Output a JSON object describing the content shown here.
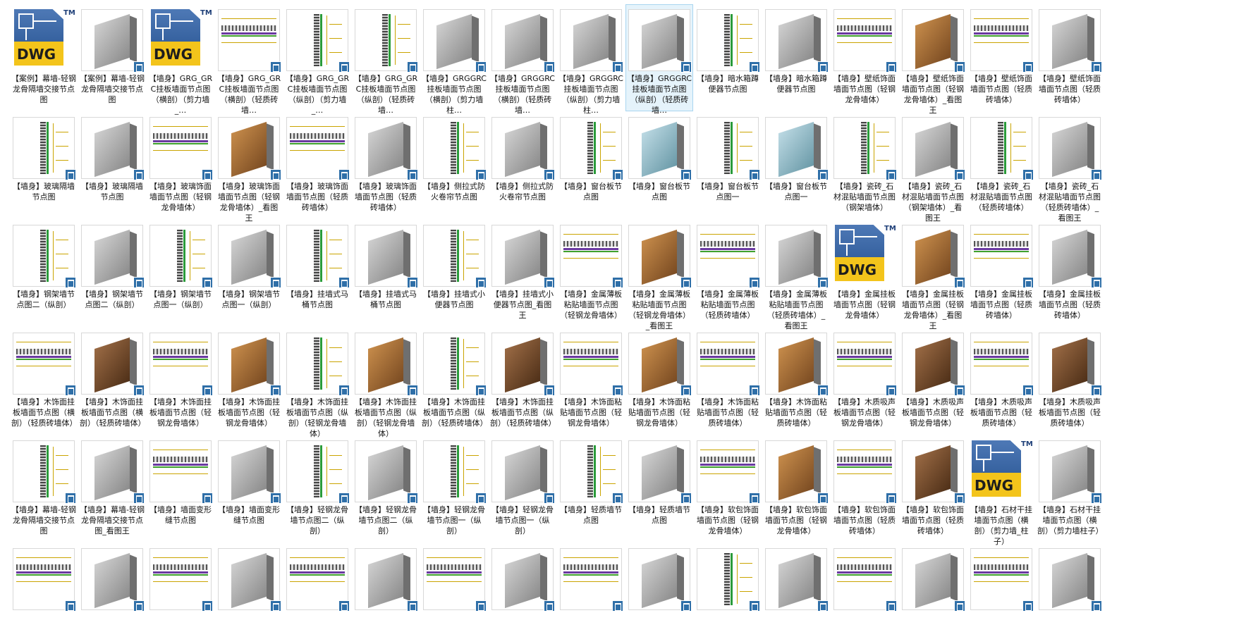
{
  "items": [
    {
      "label": "【案例】幕墙-轻钢龙骨隔墙交接节点图",
      "thumb": "dwg"
    },
    {
      "label": "【案例】幕墙-轻钢龙骨隔墙交接节点图",
      "thumb": "render"
    },
    {
      "label": "【墙身】GRG_GRC挂板墙面节点图（横剖）（剪力墙_…",
      "thumb": "dwg"
    },
    {
      "label": "【墙身】GRG_GRC挂板墙面节点图（横剖）（轻质砖墙…",
      "thumb": "plan"
    },
    {
      "label": "【墙身】GRG_GRC挂板墙面节点图（纵剖）（剪力墙_…",
      "thumb": "section"
    },
    {
      "label": "【墙身】GRG_GRC挂板墙面节点图（纵剖）（轻质砖墙…",
      "thumb": "section"
    },
    {
      "label": "【墙身】GRGGRC挂板墙面节点图（横剖）（剪力墙柱…",
      "thumb": "render"
    },
    {
      "label": "【墙身】GRGGRC挂板墙面节点图（横剖）（轻质砖墙…",
      "thumb": "render"
    },
    {
      "label": "【墙身】GRGGRC挂板墙面节点图（纵剖）（剪力墙柱…",
      "thumb": "render"
    },
    {
      "label": "【墙身】GRGGRC挂板墙面节点图（纵剖）（轻质砖墙…",
      "thumb": "render",
      "selected": true
    },
    {
      "label": "【墙身】暗水箱蹲便器节点图",
      "thumb": "section"
    },
    {
      "label": "【墙身】暗水箱蹲便器节点图",
      "thumb": "render"
    },
    {
      "label": "【墙身】壁纸饰面墙面节点图（轻钢龙骨墙体）",
      "thumb": "plan"
    },
    {
      "label": "【墙身】壁纸饰面墙面节点图（轻钢龙骨墙体）_看图王",
      "thumb": "render-wood"
    },
    {
      "label": "【墙身】壁纸饰面墙面节点图（轻质砖墙体）",
      "thumb": "plan"
    },
    {
      "label": "【墙身】壁纸饰面墙面节点图（轻质砖墙体）",
      "thumb": "render"
    },
    {
      "label": "【墙身】玻璃隔墙节点图",
      "thumb": "section"
    },
    {
      "label": "【墙身】玻璃隔墙节点图",
      "thumb": "render"
    },
    {
      "label": "【墙身】玻璃饰面墙面节点图（轻钢龙骨墙体）",
      "thumb": "plan"
    },
    {
      "label": "【墙身】玻璃饰面墙面节点图（轻钢龙骨墙体）_看图王",
      "thumb": "render-wood"
    },
    {
      "label": "【墙身】玻璃饰面墙面节点图（轻质砖墙体）",
      "thumb": "plan"
    },
    {
      "label": "【墙身】玻璃饰面墙面节点图（轻质砖墙体）",
      "thumb": "render"
    },
    {
      "label": "【墙身】侧拉式防火卷帘节点图",
      "thumb": "section"
    },
    {
      "label": "【墙身】侧拉式防火卷帘节点图",
      "thumb": "render"
    },
    {
      "label": "【墙身】窗台板节点图",
      "thumb": "section"
    },
    {
      "label": "【墙身】窗台板节点图",
      "thumb": "render-glass"
    },
    {
      "label": "【墙身】窗台板节点图一",
      "thumb": "section"
    },
    {
      "label": "【墙身】窗台板节点图一",
      "thumb": "render-glass"
    },
    {
      "label": "【墙身】瓷砖_石材混贴墙面节点图（钢架墙体）",
      "thumb": "section"
    },
    {
      "label": "【墙身】瓷砖_石材混贴墙面节点图（钢架墙体）_看图王",
      "thumb": "render"
    },
    {
      "label": "【墙身】瓷砖_石材混贴墙面节点图（轻质砖墙体）",
      "thumb": "section"
    },
    {
      "label": "【墙身】瓷砖_石材混贴墙面节点图（轻质砖墙体）_看图王",
      "thumb": "render"
    },
    {
      "label": "【墙身】钢架墙节点图二（纵剖）",
      "thumb": "section"
    },
    {
      "label": "【墙身】钢架墙节点图二（纵剖）",
      "thumb": "render"
    },
    {
      "label": "【墙身】钢架墙节点图一（纵剖）",
      "thumb": "section"
    },
    {
      "label": "【墙身】钢架墙节点图一（纵剖）",
      "thumb": "render"
    },
    {
      "label": "【墙身】挂墙式马桶节点图",
      "thumb": "section"
    },
    {
      "label": "【墙身】挂墙式马桶节点图",
      "thumb": "render"
    },
    {
      "label": "【墙身】挂墙式小便器节点图",
      "thumb": "section"
    },
    {
      "label": "【墙身】挂墙式小便器节点图_看图王",
      "thumb": "render"
    },
    {
      "label": "【墙身】金属薄板粘贴墙面节点图（轻钢龙骨墙体）",
      "thumb": "plan"
    },
    {
      "label": "【墙身】金属薄板粘贴墙面节点图（轻钢龙骨墙体）_看图王",
      "thumb": "render-wood"
    },
    {
      "label": "【墙身】金属薄板粘贴墙面节点图（轻质砖墙体）",
      "thumb": "plan"
    },
    {
      "label": "【墙身】金属薄板粘贴墙面节点图（轻质砖墙体）_看图王",
      "thumb": "render"
    },
    {
      "label": "【墙身】金属挂板墙面节点图（轻钢龙骨墙体）",
      "thumb": "dwg"
    },
    {
      "label": "【墙身】金属挂板墙面节点图（轻钢龙骨墙体）_看图王",
      "thumb": "render-wood"
    },
    {
      "label": "【墙身】金属挂板墙面节点图（轻质砖墙体）",
      "thumb": "plan"
    },
    {
      "label": "【墙身】金属挂板墙面节点图（轻质砖墙体）",
      "thumb": "render"
    },
    {
      "label": "【墙身】木饰面挂板墙面节点图（横剖）（轻质砖墙体）",
      "thumb": "plan"
    },
    {
      "label": "【墙身】木饰面挂板墙面节点图（横剖）（轻质砖墙体）",
      "thumb": "render-brown"
    },
    {
      "label": "【墙身】木饰面挂板墙面节点图（轻钢龙骨墙体）",
      "thumb": "plan"
    },
    {
      "label": "【墙身】木饰面挂板墙面节点图（轻钢龙骨墙体）",
      "thumb": "render-wood"
    },
    {
      "label": "【墙身】木饰面挂板墙面节点图（纵剖）（轻钢龙骨墙体）",
      "thumb": "section"
    },
    {
      "label": "【墙身】木饰面挂板墙面节点图（纵剖）（轻钢龙骨墙体）",
      "thumb": "render-wood"
    },
    {
      "label": "【墙身】木饰面挂板墙面节点图（纵剖）（轻质砖墙体）",
      "thumb": "section"
    },
    {
      "label": "【墙身】木饰面挂板墙面节点图（纵剖）（轻质砖墙体）",
      "thumb": "render-brown"
    },
    {
      "label": "【墙身】木饰面粘贴墙面节点图（轻钢龙骨墙体）",
      "thumb": "plan"
    },
    {
      "label": "【墙身】木饰面粘贴墙面节点图（轻钢龙骨墙体）",
      "thumb": "render-wood"
    },
    {
      "label": "【墙身】木饰面粘贴墙面节点图（轻质砖墙体）",
      "thumb": "plan"
    },
    {
      "label": "【墙身】木饰面粘贴墙面节点图（轻质砖墙体）",
      "thumb": "render-wood"
    },
    {
      "label": "【墙身】木质吸声板墙面节点图（轻钢龙骨墙体）",
      "thumb": "plan"
    },
    {
      "label": "【墙身】木质吸声板墙面节点图（轻钢龙骨墙体）",
      "thumb": "render-brown"
    },
    {
      "label": "【墙身】木质吸声板墙面节点图（轻质砖墙体）",
      "thumb": "plan"
    },
    {
      "label": "【墙身】木质吸声板墙面节点图（轻质砖墙体）",
      "thumb": "render-brown"
    },
    {
      "label": "【墙身】幕墙-轻钢龙骨隔墙交接节点图",
      "thumb": "section"
    },
    {
      "label": "【墙身】幕墙-轻钢龙骨隔墙交接节点图_看图王",
      "thumb": "render"
    },
    {
      "label": "【墙身】墙面变形缝节点图",
      "thumb": "plan"
    },
    {
      "label": "【墙身】墙面变形缝节点图",
      "thumb": "render"
    },
    {
      "label": "【墙身】轻钢龙骨墙节点图二（纵剖）",
      "thumb": "section"
    },
    {
      "label": "【墙身】轻钢龙骨墙节点图二（纵剖）",
      "thumb": "render"
    },
    {
      "label": "【墙身】轻钢龙骨墙节点图一（纵剖）",
      "thumb": "section"
    },
    {
      "label": "【墙身】轻钢龙骨墙节点图一（纵剖）",
      "thumb": "render"
    },
    {
      "label": "【墙身】轻质墙节点图",
      "thumb": "section"
    },
    {
      "label": "【墙身】轻质墙节点图",
      "thumb": "render"
    },
    {
      "label": "【墙身】软包饰面墙面节点图（轻钢龙骨墙体）",
      "thumb": "plan"
    },
    {
      "label": "【墙身】软包饰面墙面节点图（轻钢龙骨墙体）",
      "thumb": "render-wood"
    },
    {
      "label": "【墙身】软包饰面墙面节点图（轻质砖墙体）",
      "thumb": "plan"
    },
    {
      "label": "【墙身】软包饰面墙面节点图（轻质砖墙体）",
      "thumb": "render-brown"
    },
    {
      "label": "【墙身】石材干挂墙面节点图（横剖）（剪力墙_柱子）",
      "thumb": "dwg"
    },
    {
      "label": "【墙身】石材干挂墙面节点图（横剖）（剪力墙柱子）",
      "thumb": "render"
    },
    {
      "label": "",
      "thumb": "plan"
    },
    {
      "label": "",
      "thumb": "render"
    },
    {
      "label": "",
      "thumb": "plan"
    },
    {
      "label": "",
      "thumb": "render"
    },
    {
      "label": "",
      "thumb": "plan"
    },
    {
      "label": "",
      "thumb": "render"
    },
    {
      "label": "",
      "thumb": "plan"
    },
    {
      "label": "",
      "thumb": "render"
    },
    {
      "label": "",
      "thumb": "plan"
    },
    {
      "label": "",
      "thumb": "render"
    },
    {
      "label": "",
      "thumb": "section"
    },
    {
      "label": "",
      "thumb": "render"
    },
    {
      "label": "",
      "thumb": "plan"
    },
    {
      "label": "",
      "thumb": "render"
    },
    {
      "label": "",
      "thumb": "plan"
    },
    {
      "label": "",
      "thumb": "render"
    }
  ],
  "dwg_icon": {
    "text": "DWG",
    "tm": "TM"
  },
  "colors": {
    "selection_bg": "#e5f3fb",
    "selection_border": "#a9d5f0",
    "file_badge": "#2f6fa8",
    "dwg_band": "#f3c41b",
    "dwg_blue": "#24508e"
  }
}
